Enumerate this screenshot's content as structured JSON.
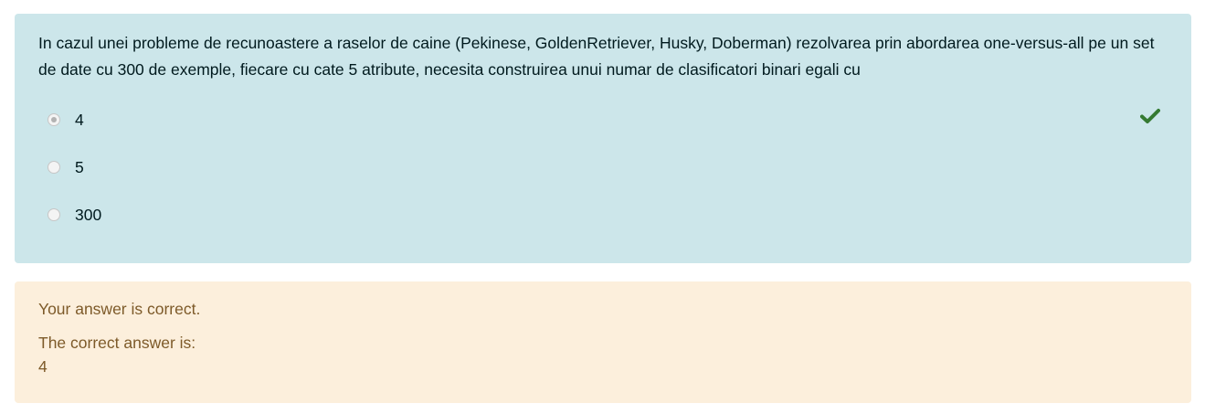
{
  "question": {
    "text": "In cazul unei probleme de recunoastere a raselor de caine (Pekinese, GoldenRetriever, Husky, Doberman) rezolvarea prin abordarea one-versus-all pe un set de date cu 300 de exemple, fiecare cu cate 5 atribute, necesita construirea unui numar de clasificatori binari egali cu",
    "answers": [
      {
        "label": "4",
        "selected": true,
        "correct": true
      },
      {
        "label": "5",
        "selected": false,
        "correct": false
      },
      {
        "label": "300",
        "selected": false,
        "correct": false
      }
    ]
  },
  "feedback": {
    "status": "Your answer is correct.",
    "correct_label": "The correct answer is:",
    "correct_value": "4"
  },
  "colors": {
    "question_bg": "#cce6ea",
    "feedback_bg": "#fcefdc",
    "check_green": "#357a32",
    "feedback_text": "#7d5a29"
  },
  "icons": {
    "correct_marker": "check-icon"
  }
}
